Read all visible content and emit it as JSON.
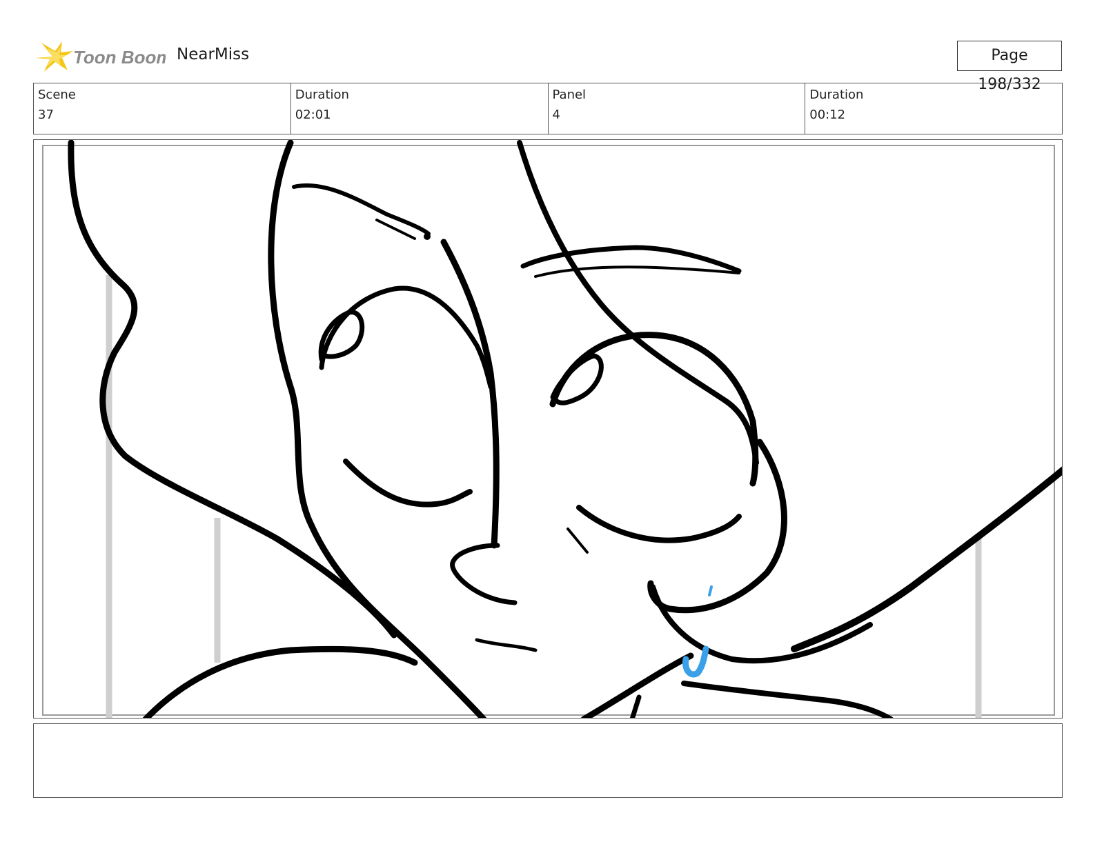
{
  "header": {
    "logo_text": "Toon Boom",
    "project_title": "NearMiss",
    "page_label": "Page 198/332"
  },
  "info": {
    "scene_label": "Scene",
    "scene_value": "37",
    "scene_duration_label": "Duration",
    "scene_duration_value": "02:01",
    "panel_label": "Panel",
    "panel_value": "4",
    "panel_duration_label": "Duration",
    "panel_duration_value": "00:12"
  },
  "notes": {
    "text": ""
  },
  "colors": {
    "logo_star": "#f5c518",
    "logo_text": "#8a8a8a",
    "stroke": "#000000",
    "accent_blue": "#3aa0e8",
    "guide_gray": "#cfcfcf"
  }
}
